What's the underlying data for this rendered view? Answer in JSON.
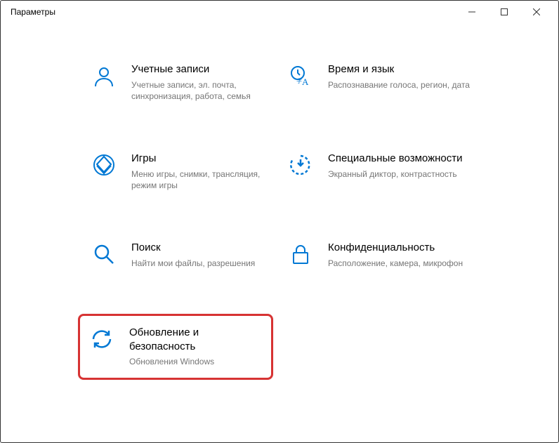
{
  "window": {
    "title": "Параметры"
  },
  "tiles": {
    "accounts": {
      "title": "Учетные записи",
      "sub": "Учетные записи, эл. почта, синхронизация, работа, семья"
    },
    "time": {
      "title": "Время и язык",
      "sub": "Распознавание голоса, регион, дата"
    },
    "gaming": {
      "title": "Игры",
      "sub": "Меню игры, снимки, трансляция, режим игры"
    },
    "ease": {
      "title": "Специальные возможности",
      "sub": "Экранный диктор, контрастность"
    },
    "search": {
      "title": "Поиск",
      "sub": "Найти мои файлы, разрешения"
    },
    "privacy": {
      "title": "Конфиденциальность",
      "sub": "Расположение, камера, микрофон"
    },
    "update": {
      "title": "Обновление и безопасность",
      "sub": "Обновления Windows"
    }
  }
}
